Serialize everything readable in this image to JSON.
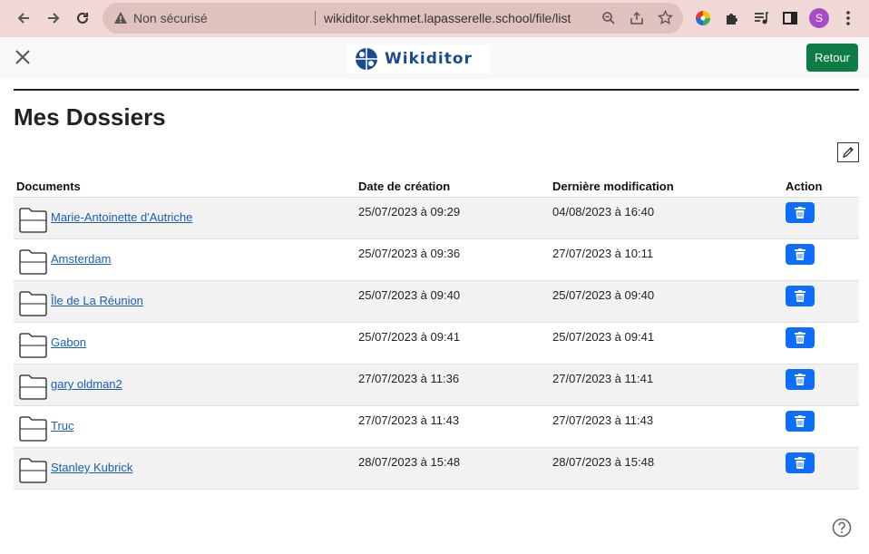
{
  "browser": {
    "security_label": "Non sécurisé",
    "url": "wikiditor.sekhmet.lapasserelle.school/file/list",
    "profile_initial": "S"
  },
  "header": {
    "logo_text": "Wikiditor",
    "back_label": "Retour"
  },
  "page": {
    "title": "Mes Dossiers"
  },
  "table": {
    "columns": {
      "documents": "Documents",
      "created": "Date de création",
      "modified": "Dernière modification",
      "action": "Action"
    },
    "rows": [
      {
        "name": "Marie-Antoinette d'Autriche",
        "created": "25/07/2023 à 09:29",
        "modified": "04/08/2023 à 16:40"
      },
      {
        "name": "Amsterdam",
        "created": "25/07/2023 à 09:36",
        "modified": "27/07/2023 à 10:11"
      },
      {
        "name": "Île de La Réunion",
        "created": "25/07/2023 à 09:40",
        "modified": "25/07/2023 à 09:40"
      },
      {
        "name": "Gabon",
        "created": "25/07/2023 à 09:41",
        "modified": "25/07/2023 à 09:41"
      },
      {
        "name": "gary oldman2",
        "created": "27/07/2023 à 11:36",
        "modified": "27/07/2023 à 11:41"
      },
      {
        "name": "Truc",
        "created": "27/07/2023 à 11:43",
        "modified": "27/07/2023 à 11:43"
      },
      {
        "name": "Stanley Kubrick",
        "created": "28/07/2023 à 15:48",
        "modified": "28/07/2023 à 15:48"
      }
    ]
  },
  "colors": {
    "chrome_bar": "#efd8d5",
    "back_button": "#0e7c47",
    "delete_button": "#0d6efd",
    "link": "#1a5fb4"
  }
}
